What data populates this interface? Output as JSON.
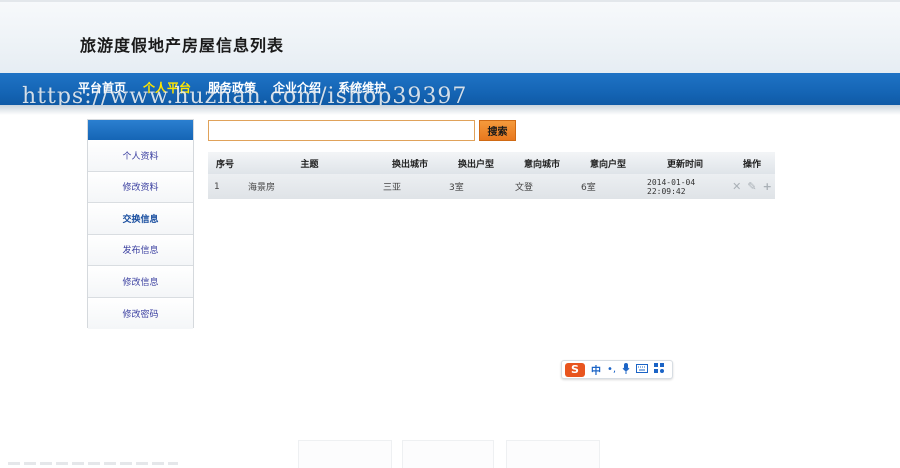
{
  "header": {
    "title": "旅游度假地产房屋信息列表"
  },
  "nav": {
    "items": [
      {
        "label": "平台首页",
        "active": false
      },
      {
        "label": "个人平台",
        "active": true
      },
      {
        "label": "服务政策",
        "active": false
      },
      {
        "label": "企业介绍",
        "active": false
      },
      {
        "label": "系统维护",
        "active": false
      }
    ],
    "watermark": "https://www.huzhan.com/ishop39397"
  },
  "sidebar": {
    "items": [
      {
        "label": "个人资料",
        "current": false
      },
      {
        "label": "修改资料",
        "current": false
      },
      {
        "label": "交换信息",
        "current": true
      },
      {
        "label": "发布信息",
        "current": false
      },
      {
        "label": "修改信息",
        "current": false
      },
      {
        "label": "修改密码",
        "current": false
      }
    ]
  },
  "search": {
    "value": "",
    "button_label": "搜索"
  },
  "table": {
    "columns": [
      "序号",
      "主题",
      "换出城市",
      "换出户型",
      "意向城市",
      "意向户型",
      "更新时间",
      "操作"
    ],
    "rows": [
      {
        "index": "1",
        "subject": "海景房",
        "out_city": "三亚",
        "out_type": "3室",
        "target_city": "文登",
        "target_type": "6室",
        "updated": "2014-01-04 22:09:42",
        "actions": [
          "delete-icon",
          "edit-icon",
          "add-icon"
        ]
      }
    ]
  },
  "ime": {
    "logo": "S",
    "mode": "中",
    "punct": "•,",
    "icons": [
      "mic-icon",
      "keyboard-icon",
      "grid-icon"
    ]
  },
  "colors": {
    "nav_blue": "#1565b5",
    "active_nav": "#ffe600",
    "search_orange": "#e8781e",
    "sidebar_link": "#3a3fa0"
  }
}
